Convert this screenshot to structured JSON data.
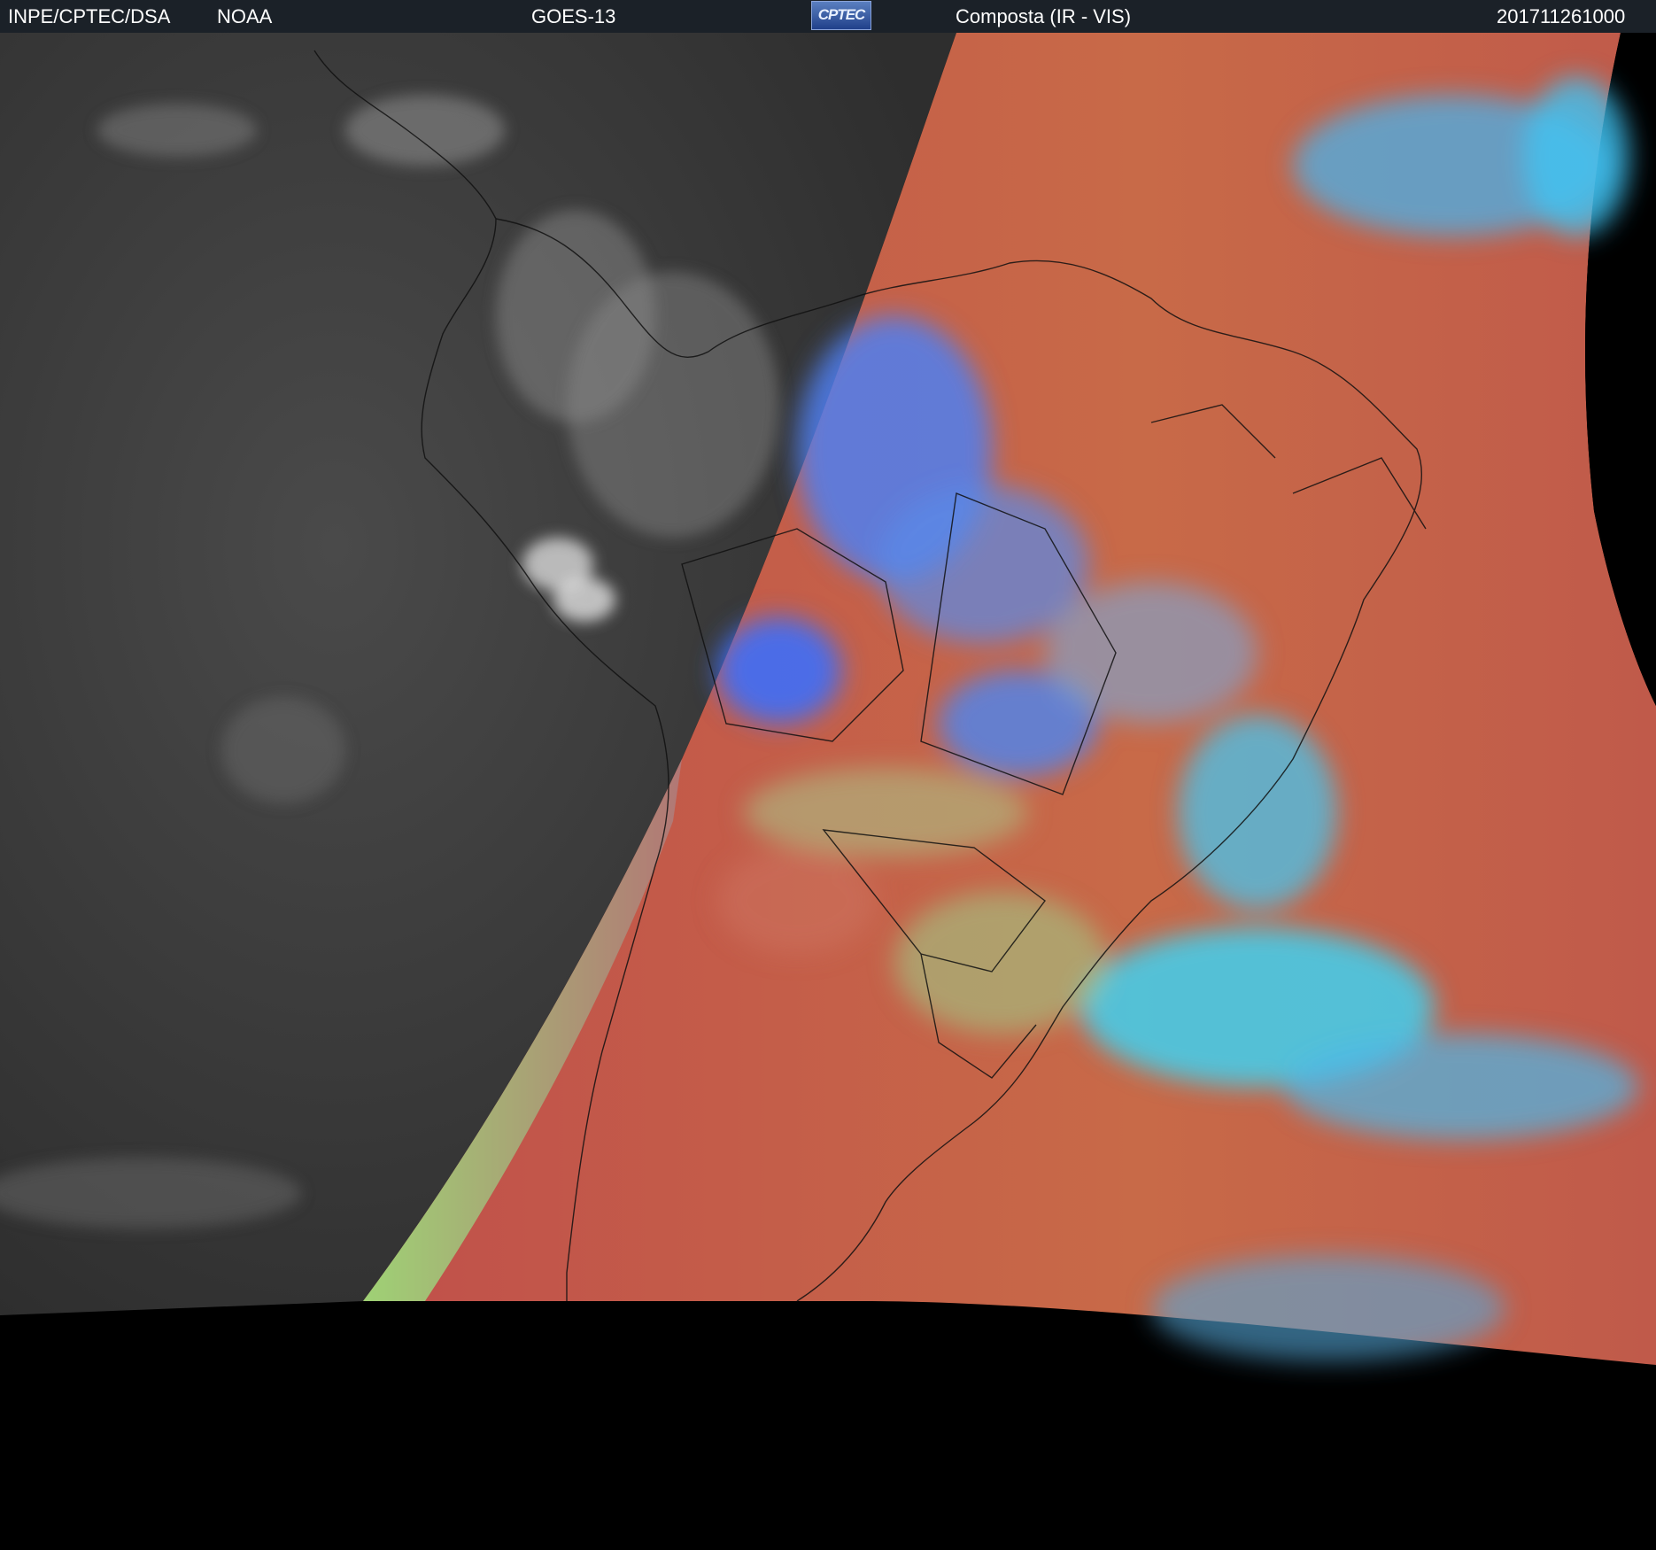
{
  "header": {
    "agency": "INPE/CPTEC/DSA",
    "partner": "NOAA",
    "satellite": "GOES-13",
    "logo_text": "CPTEC",
    "product": "Composta (IR - VIS)",
    "timestamp": "201711261000"
  },
  "colors": {
    "header_bg": "#1b2128",
    "night_side": "#3a3a3a",
    "day_land": "#b84a4a",
    "ocean_day": "#c96a44",
    "cloud_blue": "#4a8cf0",
    "cloud_cyan": "#3fd0f0",
    "terminator_green": "#8ee07a"
  }
}
